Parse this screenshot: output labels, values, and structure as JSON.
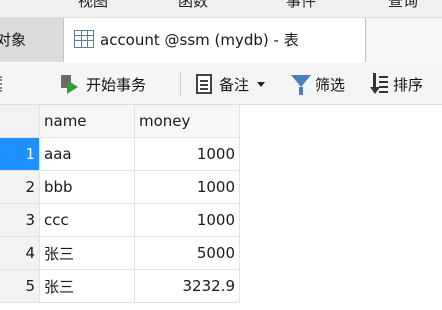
{
  "menubar": {
    "items": [
      "视图",
      "函数",
      "事件",
      "查询"
    ]
  },
  "tabs": {
    "objects_label": "对象",
    "table_tab_label": "account @ssm (mydb) - 表"
  },
  "toolbar": {
    "begin_transaction": "开始事务",
    "note": "备注",
    "filter": "筛选",
    "sort": "排序"
  },
  "grid": {
    "columns": [
      "name",
      "money"
    ],
    "rows": [
      {
        "num": "1",
        "name": "aaa",
        "money": "1000",
        "selected": true
      },
      {
        "num": "2",
        "name": "bbb",
        "money": "1000",
        "selected": false
      },
      {
        "num": "3",
        "name": "ccc",
        "money": "1000",
        "selected": false
      },
      {
        "num": "4",
        "name": "张三",
        "money": "5000",
        "selected": false
      },
      {
        "num": "5",
        "name": "张三",
        "money": "3232.9",
        "selected": false
      }
    ]
  },
  "colors": {
    "selection": "#1e90ff",
    "filter_icon": "#4a7fb8",
    "transaction_icon": "#2f9d3a"
  }
}
